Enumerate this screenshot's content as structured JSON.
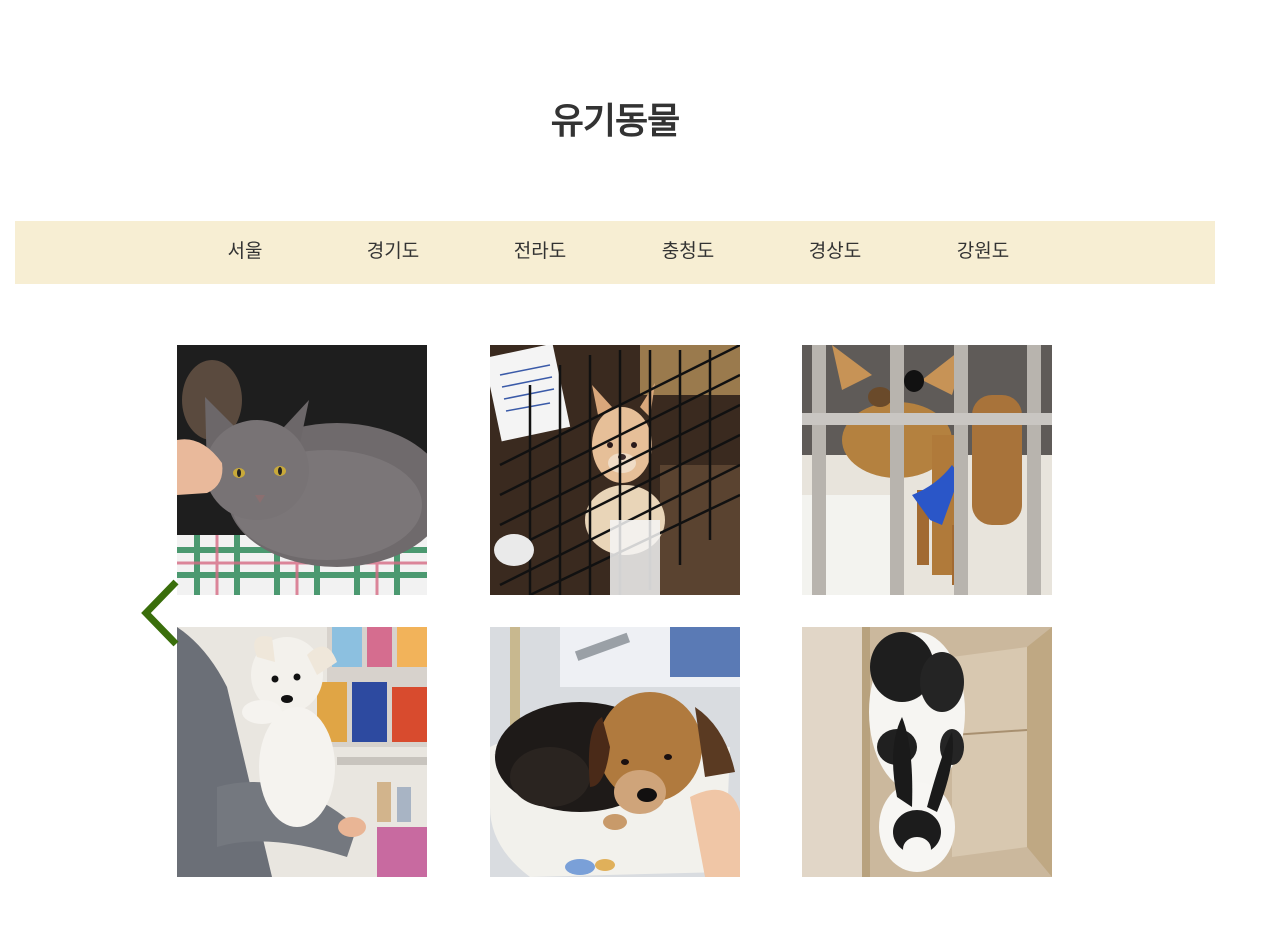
{
  "page": {
    "title": "유기동물"
  },
  "regions": [
    {
      "label": "서울"
    },
    {
      "label": "경기도"
    },
    {
      "label": "전라도"
    },
    {
      "label": "충청도"
    },
    {
      "label": "경상도"
    },
    {
      "label": "강원도"
    }
  ],
  "colors": {
    "nav_background": "#f7eed3",
    "arrow": "#3a6e0b",
    "title_text": "#333333"
  },
  "gallery": {
    "items": [
      {
        "subject": "gray-cat"
      },
      {
        "subject": "puppy-in-wire-cage"
      },
      {
        "subject": "chihuahua-behind-bars"
      },
      {
        "subject": "white-puppy-held"
      },
      {
        "subject": "dog-in-tub"
      },
      {
        "subject": "rabbit-in-box"
      }
    ],
    "prev_icon": "chevron-left-icon"
  }
}
